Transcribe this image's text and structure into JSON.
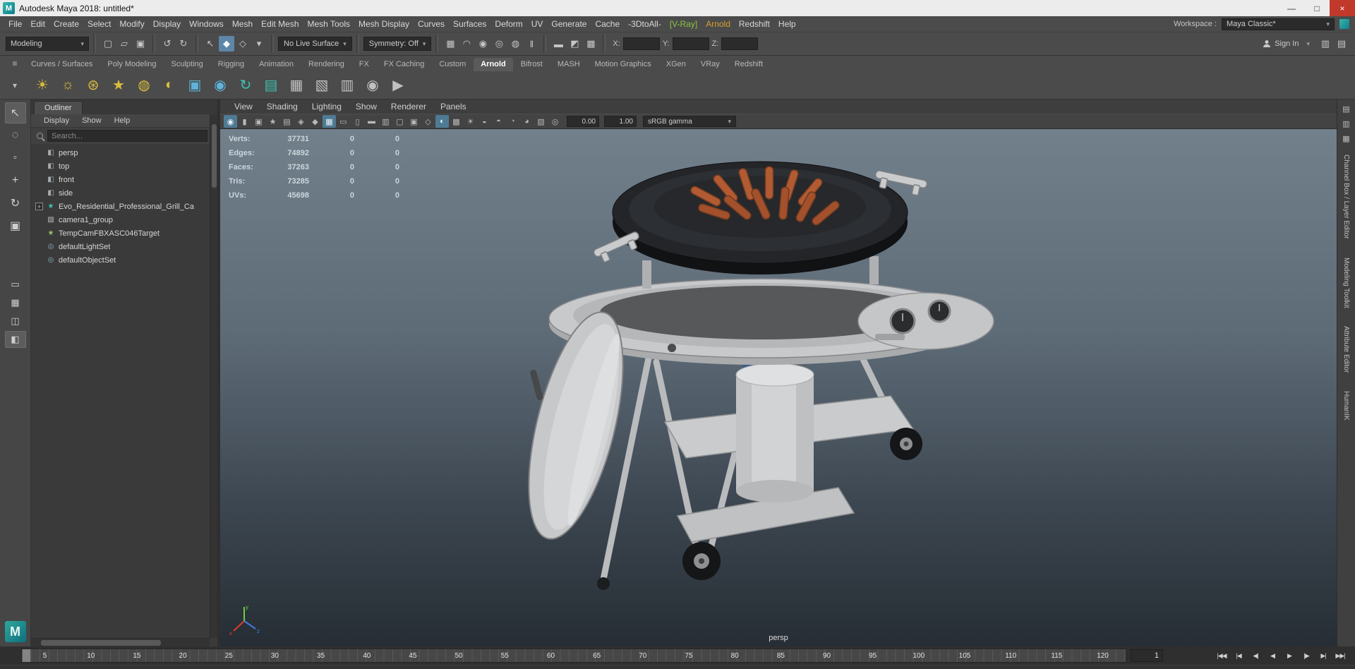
{
  "window": {
    "title": "Autodesk Maya 2018: untitled*",
    "app_glyph": "M",
    "minimize": "—",
    "maximize": "□",
    "close": "×"
  },
  "menu_bar": {
    "items": [
      {
        "label": "File"
      },
      {
        "label": "Edit"
      },
      {
        "label": "Create"
      },
      {
        "label": "Select"
      },
      {
        "label": "Modify"
      },
      {
        "label": "Display"
      },
      {
        "label": "Windows"
      },
      {
        "label": "Mesh"
      },
      {
        "label": "Edit Mesh"
      },
      {
        "label": "Mesh Tools"
      },
      {
        "label": "Mesh Display"
      },
      {
        "label": "Curves"
      },
      {
        "label": "Surfaces"
      },
      {
        "label": "Deform"
      },
      {
        "label": "UV"
      },
      {
        "label": "Generate"
      },
      {
        "label": "Cache"
      },
      {
        "label": "-3DtoAll-"
      },
      {
        "label": "[V-Ray]",
        "cls": "green"
      },
      {
        "label": "Arnold",
        "cls": "gold"
      },
      {
        "label": "Redshift"
      },
      {
        "label": "Help"
      }
    ],
    "workspace_label": "Workspace :",
    "workspace_value": "Maya Classic*"
  },
  "status_line": {
    "mode": "Modeling",
    "file_icons": [
      {
        "name": "new-scene-icon",
        "glyph": "▢"
      },
      {
        "name": "open-scene-icon",
        "glyph": "▱"
      },
      {
        "name": "save-scene-icon",
        "glyph": "▣"
      }
    ],
    "edit_icons": [
      {
        "name": "undo-icon",
        "glyph": "↺"
      },
      {
        "name": "redo-icon",
        "glyph": "↻"
      }
    ],
    "mask_icons": [
      {
        "name": "select-by-hierarchy-icon",
        "glyph": "↖"
      },
      {
        "name": "select-by-object-icon",
        "glyph": "◆",
        "cls": "active"
      },
      {
        "name": "select-by-component-icon",
        "glyph": "◇"
      },
      {
        "name": "selection-mask-menu-icon",
        "glyph": "▾"
      }
    ],
    "live_surface": "No Live Surface",
    "symmetry": "Symmetry: Off",
    "snap_icons": [
      {
        "name": "snap-to-grids-icon",
        "glyph": "▦"
      },
      {
        "name": "snap-to-curves-icon",
        "glyph": "◠"
      },
      {
        "name": "snap-to-points-icon",
        "glyph": "◉"
      },
      {
        "name": "snap-to-projected-center-icon",
        "glyph": "◎"
      },
      {
        "name": "make-live-icon",
        "glyph": "◍"
      },
      {
        "name": "pause-icon",
        "glyph": "‖"
      }
    ],
    "render_icons": [
      {
        "name": "render-frame-icon",
        "glyph": "▬"
      },
      {
        "name": "ipr-render-icon",
        "glyph": "◩"
      },
      {
        "name": "render-settings-icon",
        "glyph": "▩"
      }
    ],
    "x_label": "X:",
    "y_label": "Y:",
    "z_label": "Z:",
    "sign_in": "Sign In",
    "right_icons": [
      {
        "name": "whats-new-highlight-icon",
        "glyph": "▥"
      },
      {
        "name": "screenshot-help-icon",
        "glyph": "▤"
      }
    ]
  },
  "shelf": {
    "menu_icon": "≡",
    "overflow_icon": "▾",
    "tabs": [
      {
        "label": "Curves / Surfaces"
      },
      {
        "label": "Poly Modeling"
      },
      {
        "label": "Sculpting"
      },
      {
        "label": "Rigging"
      },
      {
        "label": "Animation"
      },
      {
        "label": "Rendering"
      },
      {
        "label": "FX"
      },
      {
        "label": "FX Caching"
      },
      {
        "label": "Custom"
      },
      {
        "label": "Arnold",
        "cls": "active"
      },
      {
        "label": "Bifrost"
      },
      {
        "label": "MASH"
      },
      {
        "label": "Motion Graphics"
      },
      {
        "label": "XGen"
      },
      {
        "label": "VRay"
      },
      {
        "label": "Redshift"
      }
    ],
    "icons": [
      {
        "name": "arnold-area-light-icon",
        "glyph": "☀",
        "color": "#d8bc3e"
      },
      {
        "name": "arnold-skydome-light-icon",
        "glyph": "☼",
        "color": "#d8bc3e"
      },
      {
        "name": "arnold-mesh-light-icon",
        "glyph": "⊛",
        "color": "#d8bc3e"
      },
      {
        "name": "arnold-photometric-light-icon",
        "glyph": "★",
        "color": "#d8bc3e"
      },
      {
        "name": "arnold-light-portal-icon",
        "glyph": "◍",
        "color": "#d8bc3e"
      },
      {
        "name": "arnold-physical-sky-icon",
        "glyph": "◐",
        "color": "#d8bc3e"
      },
      {
        "name": "arnold-standin-icon",
        "glyph": "▣",
        "color": "#5fb3d9"
      },
      {
        "name": "arnold-sphere-icon",
        "glyph": "◉",
        "color": "#5fb3d9"
      },
      {
        "name": "arnold-flush-cache-icon",
        "glyph": "↻",
        "color": "#3ec0ae"
      },
      {
        "name": "arnold-volume-icon",
        "glyph": "▤",
        "color": "#3ec0ae"
      },
      {
        "name": "tx-manager-icon",
        "glyph": "▦",
        "color": "#c0c0c0"
      },
      {
        "name": "update-tx-icon",
        "glyph": "▧",
        "color": "#c0c0c0"
      },
      {
        "name": "light-manager-icon",
        "glyph": "▥",
        "color": "#c0c0c0"
      },
      {
        "name": "arnold-render-icon",
        "glyph": "◉",
        "color": "#c0c0c0"
      },
      {
        "name": "arnold-ipr-icon",
        "glyph": "▶",
        "color": "#c0c0c0"
      }
    ]
  },
  "toolbox": {
    "tools": [
      {
        "name": "select-tool",
        "glyph": "↖",
        "cls": "active"
      },
      {
        "name": "lasso-select-tool",
        "glyph": "◌"
      },
      {
        "name": "paint-select-tool",
        "glyph": "◦"
      },
      {
        "name": "move-tool",
        "glyph": "+"
      },
      {
        "name": "rotate-tool",
        "glyph": "↻"
      },
      {
        "name": "scale-tool",
        "glyph": "▣"
      }
    ],
    "layouts": [
      {
        "name": "single-pane-layout-button",
        "glyph": "▭"
      },
      {
        "name": "four-pane-layout-button",
        "glyph": "▦"
      },
      {
        "name": "split-pane-layout-button",
        "glyph": "◫"
      },
      {
        "name": "outliner-persp-layout-button",
        "glyph": "◧",
        "cls": "active"
      }
    ],
    "logo_glyph": "M"
  },
  "outliner": {
    "tab": "Outliner",
    "menus": [
      {
        "label": "Display"
      },
      {
        "label": "Show"
      },
      {
        "label": "Help"
      }
    ],
    "search_placeholder": "Search...",
    "items": [
      {
        "exp": "",
        "icon": "◧",
        "label": "persp",
        "cls": "i-cam"
      },
      {
        "exp": "",
        "icon": "◧",
        "label": "top",
        "cls": "i-cam"
      },
      {
        "exp": "",
        "icon": "◧",
        "label": "front",
        "cls": "i-cam"
      },
      {
        "exp": "",
        "icon": "◧",
        "label": "side",
        "cls": "i-cam"
      },
      {
        "exp": "+",
        "icon": "★",
        "label": "Evo_Residential_Professional_Grill_Ca",
        "cls": "i-mesh has-exp"
      },
      {
        "exp": "",
        "icon": "▧",
        "label": "camera1_group",
        "cls": "i-group"
      },
      {
        "exp": "",
        "icon": "★",
        "label": "TempCamFBXASC046Target",
        "cls": "i-target"
      },
      {
        "exp": "",
        "icon": "◎",
        "label": "defaultLightSet",
        "cls": "i-set"
      },
      {
        "exp": "",
        "icon": "◎",
        "label": "defaultObjectSet",
        "cls": "i-set"
      }
    ]
  },
  "viewport": {
    "menus": [
      {
        "label": "View"
      },
      {
        "label": "Shading"
      },
      {
        "label": "Lighting"
      },
      {
        "label": "Show"
      },
      {
        "label": "Renderer"
      },
      {
        "label": "Panels"
      }
    ],
    "icons": [
      {
        "name": "renderer-select-icon",
        "glyph": "◉",
        "cls": "active"
      },
      {
        "name": "lock-camera-icon",
        "glyph": "▮"
      },
      {
        "name": "camera-attributes-icon",
        "glyph": "▣"
      },
      {
        "name": "bookmarks-icon",
        "glyph": "★"
      },
      {
        "name": "image-plane-icon",
        "glyph": "▤"
      },
      {
        "name": "two-d-pan-zoom-icon",
        "glyph": "◈"
      },
      {
        "name": "grease-pencil-icon",
        "glyph": "◆"
      },
      {
        "name": "grid-toggle-icon",
        "glyph": "▦",
        "cls": "active"
      },
      {
        "name": "film-gate-icon",
        "glyph": "▭"
      },
      {
        "name": "resolution-gate-icon",
        "glyph": "▯"
      },
      {
        "name": "gate-mask-icon",
        "glyph": "▬"
      },
      {
        "name": "field-chart-icon",
        "glyph": "▥"
      },
      {
        "name": "safe-action-icon",
        "glyph": "▢"
      },
      {
        "name": "safe-title-icon",
        "glyph": "▣"
      },
      {
        "name": "wireframe-icon",
        "glyph": "◇"
      },
      {
        "name": "shaded-icon",
        "glyph": "◐",
        "cls": "active"
      },
      {
        "name": "textured-icon",
        "glyph": "▩"
      },
      {
        "name": "use-all-lights-icon",
        "glyph": "☀"
      },
      {
        "name": "shadows-icon",
        "glyph": "◒"
      },
      {
        "name": "ambient-occlusion-icon",
        "glyph": "◓"
      },
      {
        "name": "motion-blur-icon",
        "glyph": "◔"
      },
      {
        "name": "anti-alias-icon",
        "glyph": "◕"
      },
      {
        "name": "xray-icon",
        "glyph": "▧"
      },
      {
        "name": "isolate-select-icon",
        "glyph": "◎"
      }
    ],
    "exposure": "0.00",
    "gamma": "1.00",
    "colorspace": "sRGB gamma",
    "hud": [
      {
        "label": "Verts:",
        "value": "37731",
        "a": "0",
        "b": "0"
      },
      {
        "label": "Edges:",
        "value": "74892",
        "a": "0",
        "b": "0"
      },
      {
        "label": "Faces:",
        "value": "37263",
        "a": "0",
        "b": "0"
      },
      {
        "label": "Tris:",
        "value": "73285",
        "a": "0",
        "b": "0"
      },
      {
        "label": "UVs:",
        "value": "45698",
        "a": "0",
        "b": "0"
      }
    ],
    "camera_label": "persp"
  },
  "right_sidebar": {
    "icons": [
      {
        "name": "attribute-editor-toggle-icon",
        "glyph": "▤"
      },
      {
        "name": "tool-settings-toggle-icon",
        "glyph": "▥"
      },
      {
        "name": "channel-box-toggle-icon",
        "glyph": "▦"
      }
    ],
    "tabs": [
      {
        "label": "Channel Box / Layer Editor"
      },
      {
        "label": "Modeling Toolkit"
      },
      {
        "label": "Attribute Editor"
      },
      {
        "label": "HumanIK"
      }
    ]
  },
  "timeline": {
    "ticks": [
      "5",
      "10",
      "15",
      "20",
      "25",
      "30",
      "35",
      "40",
      "45",
      "50",
      "55",
      "60",
      "65",
      "70",
      "75",
      "80",
      "85",
      "90",
      "95",
      "100",
      "105",
      "110",
      "115",
      "120"
    ],
    "current_frame": "1",
    "playback": [
      {
        "name": "go-to-start-button",
        "glyph": "|◀◀"
      },
      {
        "name": "step-back-key-button",
        "glyph": "|◀"
      },
      {
        "name": "step-back-frame-button",
        "glyph": "◀|"
      },
      {
        "name": "play-backwards-button",
        "glyph": "◀"
      },
      {
        "name": "play-forwards-button",
        "glyph": "▶"
      },
      {
        "name": "step-forward-frame-button",
        "glyph": "|▶"
      },
      {
        "name": "step-forward-key-button",
        "glyph": "▶|"
      },
      {
        "name": "go-to-end-button",
        "glyph": "▶▶|"
      }
    ]
  },
  "colors": {
    "accent_teal": "#19a89c",
    "vray_green": "#8bc53f",
    "arnold_gold": "#d79f2f",
    "viewport_top": "#72808c",
    "viewport_bottom": "#262d34"
  }
}
